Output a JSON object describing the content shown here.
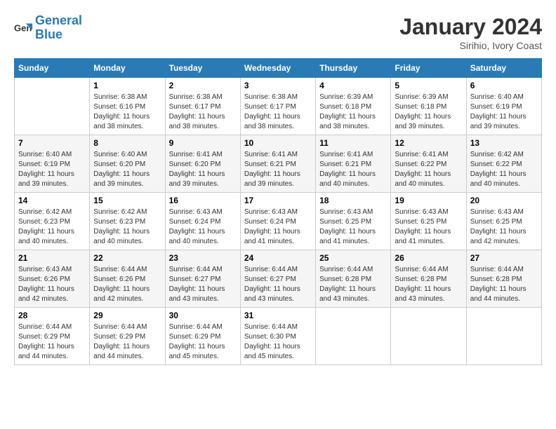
{
  "header": {
    "logo_line1": "General",
    "logo_line2": "Blue",
    "month_title": "January 2024",
    "location": "Sirihio, Ivory Coast"
  },
  "days_of_week": [
    "Sunday",
    "Monday",
    "Tuesday",
    "Wednesday",
    "Thursday",
    "Friday",
    "Saturday"
  ],
  "weeks": [
    [
      {
        "day": "",
        "info": ""
      },
      {
        "day": "1",
        "info": "Sunrise: 6:38 AM\nSunset: 6:16 PM\nDaylight: 11 hours and 38 minutes."
      },
      {
        "day": "2",
        "info": "Sunrise: 6:38 AM\nSunset: 6:17 PM\nDaylight: 11 hours and 38 minutes."
      },
      {
        "day": "3",
        "info": "Sunrise: 6:38 AM\nSunset: 6:17 PM\nDaylight: 11 hours and 38 minutes."
      },
      {
        "day": "4",
        "info": "Sunrise: 6:39 AM\nSunset: 6:18 PM\nDaylight: 11 hours and 38 minutes."
      },
      {
        "day": "5",
        "info": "Sunrise: 6:39 AM\nSunset: 6:18 PM\nDaylight: 11 hours and 39 minutes."
      },
      {
        "day": "6",
        "info": "Sunrise: 6:40 AM\nSunset: 6:19 PM\nDaylight: 11 hours and 39 minutes."
      }
    ],
    [
      {
        "day": "7",
        "info": "Sunrise: 6:40 AM\nSunset: 6:19 PM\nDaylight: 11 hours and 39 minutes."
      },
      {
        "day": "8",
        "info": "Sunrise: 6:40 AM\nSunset: 6:20 PM\nDaylight: 11 hours and 39 minutes."
      },
      {
        "day": "9",
        "info": "Sunrise: 6:41 AM\nSunset: 6:20 PM\nDaylight: 11 hours and 39 minutes."
      },
      {
        "day": "10",
        "info": "Sunrise: 6:41 AM\nSunset: 6:21 PM\nDaylight: 11 hours and 39 minutes."
      },
      {
        "day": "11",
        "info": "Sunrise: 6:41 AM\nSunset: 6:21 PM\nDaylight: 11 hours and 40 minutes."
      },
      {
        "day": "12",
        "info": "Sunrise: 6:41 AM\nSunset: 6:22 PM\nDaylight: 11 hours and 40 minutes."
      },
      {
        "day": "13",
        "info": "Sunrise: 6:42 AM\nSunset: 6:22 PM\nDaylight: 11 hours and 40 minutes."
      }
    ],
    [
      {
        "day": "14",
        "info": "Sunrise: 6:42 AM\nSunset: 6:23 PM\nDaylight: 11 hours and 40 minutes."
      },
      {
        "day": "15",
        "info": "Sunrise: 6:42 AM\nSunset: 6:23 PM\nDaylight: 11 hours and 40 minutes."
      },
      {
        "day": "16",
        "info": "Sunrise: 6:43 AM\nSunset: 6:24 PM\nDaylight: 11 hours and 40 minutes."
      },
      {
        "day": "17",
        "info": "Sunrise: 6:43 AM\nSunset: 6:24 PM\nDaylight: 11 hours and 41 minutes."
      },
      {
        "day": "18",
        "info": "Sunrise: 6:43 AM\nSunset: 6:25 PM\nDaylight: 11 hours and 41 minutes."
      },
      {
        "day": "19",
        "info": "Sunrise: 6:43 AM\nSunset: 6:25 PM\nDaylight: 11 hours and 41 minutes."
      },
      {
        "day": "20",
        "info": "Sunrise: 6:43 AM\nSunset: 6:25 PM\nDaylight: 11 hours and 42 minutes."
      }
    ],
    [
      {
        "day": "21",
        "info": "Sunrise: 6:43 AM\nSunset: 6:26 PM\nDaylight: 11 hours and 42 minutes."
      },
      {
        "day": "22",
        "info": "Sunrise: 6:44 AM\nSunset: 6:26 PM\nDaylight: 11 hours and 42 minutes."
      },
      {
        "day": "23",
        "info": "Sunrise: 6:44 AM\nSunset: 6:27 PM\nDaylight: 11 hours and 43 minutes."
      },
      {
        "day": "24",
        "info": "Sunrise: 6:44 AM\nSunset: 6:27 PM\nDaylight: 11 hours and 43 minutes."
      },
      {
        "day": "25",
        "info": "Sunrise: 6:44 AM\nSunset: 6:28 PM\nDaylight: 11 hours and 43 minutes."
      },
      {
        "day": "26",
        "info": "Sunrise: 6:44 AM\nSunset: 6:28 PM\nDaylight: 11 hours and 43 minutes."
      },
      {
        "day": "27",
        "info": "Sunrise: 6:44 AM\nSunset: 6:28 PM\nDaylight: 11 hours and 44 minutes."
      }
    ],
    [
      {
        "day": "28",
        "info": "Sunrise: 6:44 AM\nSunset: 6:29 PM\nDaylight: 11 hours and 44 minutes."
      },
      {
        "day": "29",
        "info": "Sunrise: 6:44 AM\nSunset: 6:29 PM\nDaylight: 11 hours and 44 minutes."
      },
      {
        "day": "30",
        "info": "Sunrise: 6:44 AM\nSunset: 6:29 PM\nDaylight: 11 hours and 45 minutes."
      },
      {
        "day": "31",
        "info": "Sunrise: 6:44 AM\nSunset: 6:30 PM\nDaylight: 11 hours and 45 minutes."
      },
      {
        "day": "",
        "info": ""
      },
      {
        "day": "",
        "info": ""
      },
      {
        "day": "",
        "info": ""
      }
    ]
  ]
}
